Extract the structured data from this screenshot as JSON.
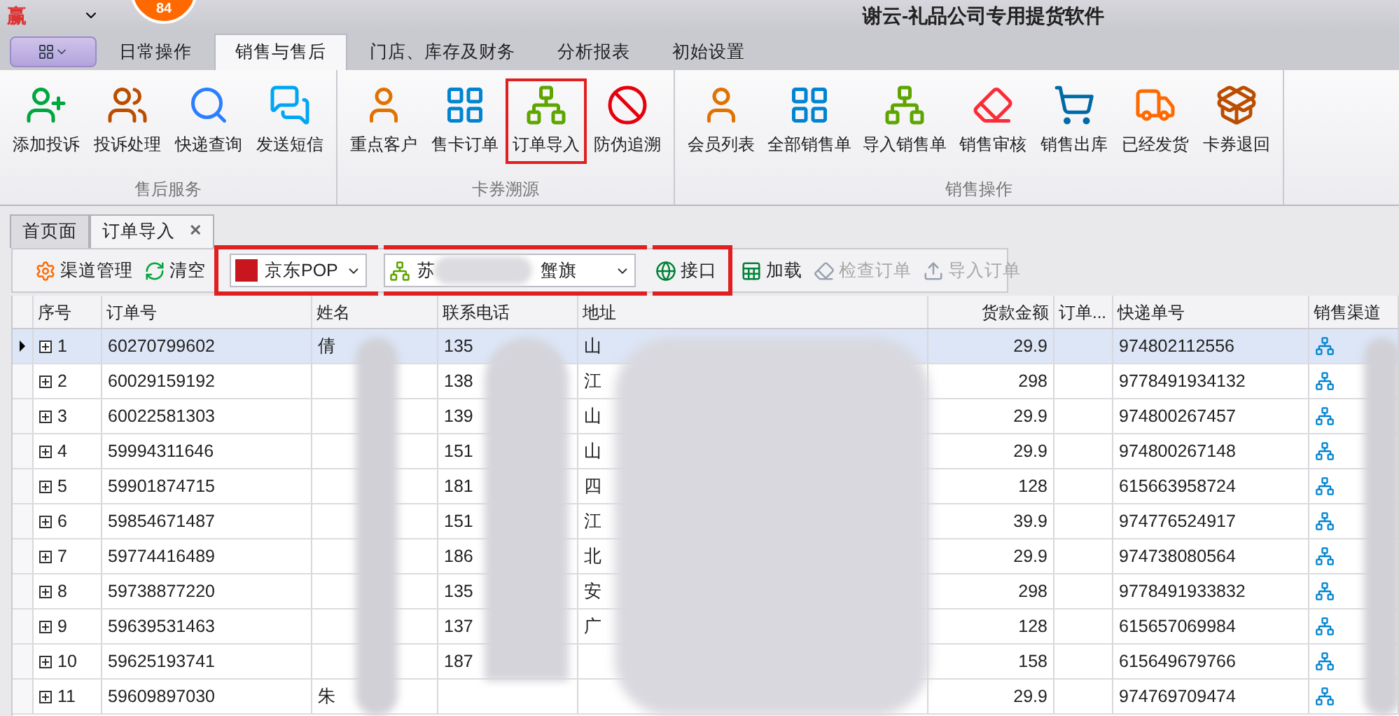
{
  "title_bar": {
    "logo": "赢",
    "badge": "84",
    "title": "谢云-礼品公司专用提货软件"
  },
  "ribbon": {
    "tabs": [
      {
        "label": "日常操作",
        "selected": false
      },
      {
        "label": "销售与售后",
        "selected": true
      },
      {
        "label": "门店、库存及财务",
        "selected": false
      },
      {
        "label": "分析报表",
        "selected": false
      },
      {
        "label": "初始设置",
        "selected": false
      }
    ],
    "groups": [
      {
        "title": "售后服务",
        "buttons": [
          {
            "label": "添加投诉",
            "highlighted": false
          },
          {
            "label": "投诉处理",
            "highlighted": false
          },
          {
            "label": "快递查询",
            "highlighted": false
          },
          {
            "label": "发送短信",
            "highlighted": false
          }
        ]
      },
      {
        "title": "卡券溯源",
        "buttons": [
          {
            "label": "重点客户",
            "highlighted": false
          },
          {
            "label": "售卡订单",
            "highlighted": false
          },
          {
            "label": "订单导入",
            "highlighted": true
          },
          {
            "label": "防伪追溯",
            "highlighted": false
          }
        ]
      },
      {
        "title": "销售操作",
        "buttons": [
          {
            "label": "会员列表",
            "highlighted": false
          },
          {
            "label": "全部销售单",
            "highlighted": false
          },
          {
            "label": "导入销售单",
            "highlighted": false
          },
          {
            "label": "销售审核",
            "highlighted": false
          },
          {
            "label": "销售出库",
            "highlighted": false
          },
          {
            "label": "已经发货",
            "highlighted": false
          },
          {
            "label": "卡券退回",
            "highlighted": false
          }
        ]
      }
    ]
  },
  "doc_tabs": [
    {
      "label": "首页面",
      "selected": false
    },
    {
      "label": "订单导入",
      "selected": true,
      "close": "✕"
    }
  ],
  "toolbar": {
    "items": [
      {
        "kind": "button",
        "label": "渠道管理",
        "disabled": false,
        "highlighted": false
      },
      {
        "kind": "button",
        "label": "清空",
        "disabled": false,
        "highlighted": false
      },
      {
        "kind": "combo",
        "parts": [
          "京东POP"
        ],
        "highlighted": true
      },
      {
        "kind": "combo",
        "parts": [
          "苏",
          "蟹旗"
        ],
        "highlighted": true
      },
      {
        "kind": "button",
        "label": "接口",
        "disabled": false,
        "highlighted": true
      },
      {
        "kind": "button",
        "label": "加载",
        "disabled": false,
        "highlighted": false
      },
      {
        "kind": "button",
        "label": "检查订单",
        "disabled": true,
        "highlighted": false
      },
      {
        "kind": "button",
        "label": "导入订单",
        "disabled": true,
        "highlighted": false
      }
    ]
  },
  "table": {
    "columns": [
      "序号",
      "订单号",
      "姓名",
      "联系电话",
      "地址",
      "货款金额",
      "订单...",
      "快递单号",
      "销售渠道"
    ],
    "rows": [
      {
        "selected": true,
        "cells": [
          "1",
          "60270799602",
          "倩",
          "135",
          "山",
          "29.9",
          "",
          "974802112556",
          ""
        ]
      },
      {
        "selected": false,
        "cells": [
          "2",
          "60029159192",
          "",
          "138",
          "江",
          "298",
          "",
          "9778491934132",
          ""
        ]
      },
      {
        "selected": false,
        "cells": [
          "3",
          "60022581303",
          "",
          "139",
          "山",
          "29.9",
          "",
          "974800267457",
          ""
        ]
      },
      {
        "selected": false,
        "cells": [
          "4",
          "59994311646",
          "",
          "151",
          "山",
          "29.9",
          "",
          "974800267148",
          ""
        ]
      },
      {
        "selected": false,
        "cells": [
          "5",
          "59901874715",
          "",
          "181",
          "四",
          "128",
          "",
          "615663958724",
          ""
        ]
      },
      {
        "selected": false,
        "cells": [
          "6",
          "59854671487",
          "",
          "151",
          "江",
          "39.9",
          "",
          "974776524917",
          ""
        ]
      },
      {
        "selected": false,
        "cells": [
          "7",
          "59774416489",
          "",
          "186",
          "北",
          "29.9",
          "",
          "974738080564",
          ""
        ]
      },
      {
        "selected": false,
        "cells": [
          "8",
          "59738877220",
          "",
          "135",
          "安",
          "298",
          "",
          "9778491933832",
          ""
        ]
      },
      {
        "selected": false,
        "cells": [
          "9",
          "59639531463",
          "",
          "137",
          "广",
          "128",
          "",
          "615657069984",
          ""
        ]
      },
      {
        "selected": false,
        "cells": [
          "10",
          "59625193741",
          "",
          "187",
          "",
          "158",
          "",
          "615649679766",
          ""
        ]
      },
      {
        "selected": false,
        "cells": [
          "11",
          "59609897030",
          "朱",
          "",
          "",
          "29.9",
          "",
          "974769709474",
          ""
        ]
      }
    ]
  }
}
